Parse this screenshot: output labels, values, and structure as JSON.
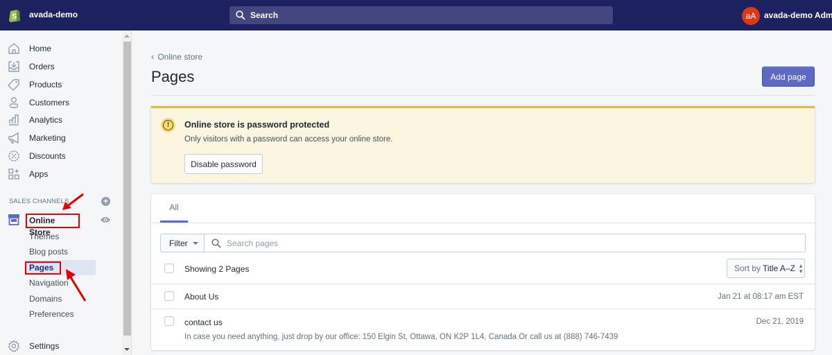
{
  "topbar": {
    "store_name": "avada-demo",
    "search_placeholder": "Search",
    "avatar_initials": "aA",
    "user_name": "avada-demo Admin"
  },
  "sidebar": {
    "items": [
      {
        "label": "Home",
        "icon": "home-icon"
      },
      {
        "label": "Orders",
        "icon": "orders-icon"
      },
      {
        "label": "Products",
        "icon": "tag-icon"
      },
      {
        "label": "Customers",
        "icon": "person-icon"
      },
      {
        "label": "Analytics",
        "icon": "bar-chart-icon"
      },
      {
        "label": "Marketing",
        "icon": "megaphone-icon"
      },
      {
        "label": "Discounts",
        "icon": "discount-icon"
      },
      {
        "label": "Apps",
        "icon": "apps-icon"
      }
    ],
    "sales_channels_title": "SALES CHANNELS",
    "online_store_label": "Online Store",
    "sub_items": [
      {
        "label": "Themes"
      },
      {
        "label": "Blog posts"
      },
      {
        "label": "Pages",
        "active": true
      },
      {
        "label": "Navigation"
      },
      {
        "label": "Domains"
      },
      {
        "label": "Preferences"
      }
    ],
    "settings_label": "Settings"
  },
  "main": {
    "breadcrumb": "Online store",
    "title": "Pages",
    "add_button": "Add page",
    "banner": {
      "title": "Online store is password protected",
      "text": "Only visitors with a password can access your online store.",
      "button": "Disable password"
    },
    "tabs": [
      {
        "label": "All",
        "active": true
      }
    ],
    "filter_label": "Filter",
    "search_placeholder": "Search pages",
    "showing_text": "Showing 2 Pages",
    "sort_prefix": "Sort by",
    "sort_value": "Title A–Z",
    "rows": [
      {
        "title": "About Us",
        "date": "Jan 21 at 08:17 am EST",
        "description": ""
      },
      {
        "title": "contact us",
        "date": "Dec 21, 2019",
        "description": "In case you need anything, just drop by our office: 150 Elgin St, Ottawa, ON K2P 1L4, Canada Or call us at (888) 746-7439"
      }
    ]
  },
  "colors": {
    "topbar": "#1c2260",
    "primary": "#5c6ac4",
    "warning_border": "#eec200",
    "warning_bg": "#fcf5e0",
    "annotation_red": "#e20000",
    "avatar": "#de3618"
  }
}
